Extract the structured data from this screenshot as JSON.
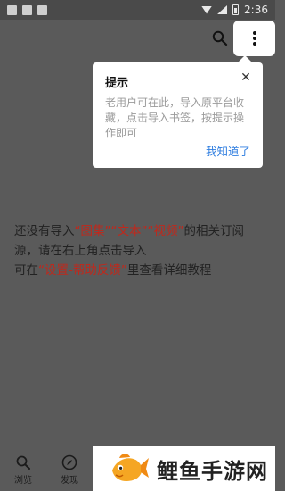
{
  "status_bar": {
    "time": "2:36"
  },
  "toolbar": {
    "search_icon": "search-icon",
    "more_icon": "more-vert-icon"
  },
  "empty_message": {
    "seg1": "还没有导入",
    "seg2": "“图集”“文本”“视频”",
    "seg3": "的相关订阅源，请在右上角点击导入",
    "seg4": "可在",
    "seg5": "“设置-帮助反馈”",
    "seg6": "里查看详细教程"
  },
  "popup": {
    "title": "提示",
    "body": "老用户可在此，导入原平台收藏，点击导入书签，按提示操作即可",
    "ack": "我知道了"
  },
  "bottom_nav": [
    {
      "label": "浏览",
      "icon": "search-icon"
    },
    {
      "label": "发现",
      "icon": "compass-icon"
    }
  ],
  "watermark": {
    "text": "鲤鱼手游网"
  },
  "colors": {
    "highlight": "#c0281c",
    "link": "#2f7ee0",
    "overlay": "#5a5a5a"
  }
}
